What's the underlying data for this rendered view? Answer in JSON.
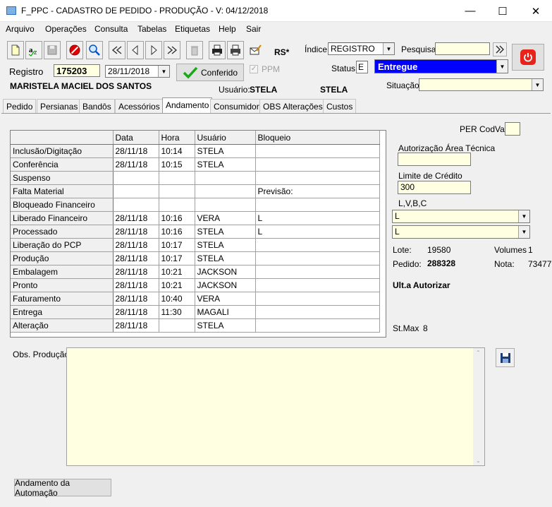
{
  "window": {
    "title": "F_PPC - CADASTRO DE PEDIDO - PRODUÇÃO - V: 04/12/2018"
  },
  "menu": [
    "Arquivo",
    "Operações",
    "Consulta",
    "Tabelas",
    "Etiquetas",
    "Help",
    "Sair"
  ],
  "toolbar": {
    "rs_label": "RS*",
    "indice_label": "Índice",
    "indice_value": "REGISTRO",
    "pesquisa_label": "Pesquisa",
    "pesquisa_value": ""
  },
  "record": {
    "registro_label": "Registro",
    "registro_value": "175203",
    "date_value": "28/11/2018",
    "conferido_label": "Conferido",
    "ppm_label": "PPM",
    "status_label": "Status",
    "status_code": "E",
    "status_value": "Entregue",
    "customer": "MARISTELA MACIEL DOS SANTOS",
    "usuario_label": "Usuário:",
    "usuario_value": "STELA",
    "usuario_value2": "STELA",
    "situacao_label": "Situação",
    "situacao_value": ""
  },
  "tabs": [
    "Pedido",
    "Persianas",
    "Bandôs",
    "Acessórios",
    "Andamento",
    "Consumidor",
    "OBS Alterações",
    "Custos"
  ],
  "grid": {
    "headers": [
      "",
      "Data",
      "Hora",
      "Usuário",
      "Bloqueio"
    ],
    "rows": [
      [
        "Inclusão/Digitação",
        "28/11/18",
        "10:14",
        "STELA",
        ""
      ],
      [
        "Conferência",
        "28/11/18",
        "10:15",
        "STELA",
        ""
      ],
      [
        "Suspenso",
        "",
        "",
        "",
        ""
      ],
      [
        "Falta Material",
        "",
        "",
        "",
        "Previsão:"
      ],
      [
        "Bloqueado Financeiro",
        "",
        "",
        "",
        ""
      ],
      [
        "Liberado Financeiro",
        "28/11/18",
        "10:16",
        "VERA",
        "L"
      ],
      [
        "Processado",
        "28/11/18",
        "10:16",
        "STELA",
        "L"
      ],
      [
        "Liberação do PCP",
        "28/11/18",
        "10:17",
        "STELA",
        ""
      ],
      [
        "Produção",
        "28/11/18",
        "10:17",
        "STELA",
        ""
      ],
      [
        "Embalagem",
        "28/11/18",
        "10:21",
        "JACKSON",
        ""
      ],
      [
        "Pronto",
        "28/11/18",
        "10:21",
        "JACKSON",
        ""
      ],
      [
        "Faturamento",
        "28/11/18",
        "10:40",
        "VERA",
        ""
      ],
      [
        "Entrega",
        "28/11/18",
        "11:30",
        "MAGALI",
        ""
      ],
      [
        "Alteração",
        "28/11/18",
        "",
        "STELA",
        ""
      ]
    ]
  },
  "side": {
    "per_codval_label": "PER CodVal",
    "per_codval_value": "",
    "autorizacao_label": "Autorização Área Técnica",
    "autorizacao_value": "",
    "limite_label": "Limite de Crédito",
    "limite_value": "300",
    "lvbc_label": "L,V,B,C",
    "combo1": "L",
    "combo2": "L",
    "lote_label": "Lote:",
    "lote_value": "19580",
    "volumes_label": "Volumes",
    "volumes_value": "1",
    "pedido_label": "Pedido:",
    "pedido_value": "288328",
    "nota_label": "Nota:",
    "nota_value": "73477",
    "ult_label": "Ult.a Autorizar",
    "stmax_label": "St.Max",
    "stmax_value": "8"
  },
  "obs": {
    "label": "Obs. Produção",
    "value": ""
  },
  "bottom": {
    "automacao_button": "Andamento da Automação"
  },
  "colors": {
    "status_bg": "#0000ff",
    "memo_bg": "#ffffe1",
    "power_red": "#e8231c"
  }
}
